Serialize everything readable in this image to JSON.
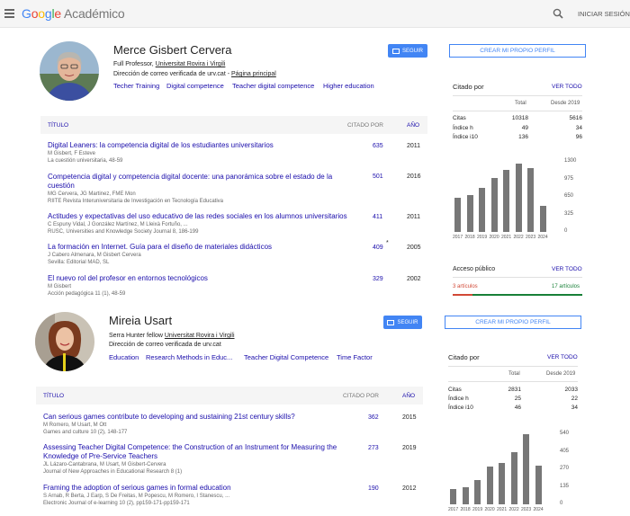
{
  "header": {
    "logo_parts": [
      "G",
      "o",
      "o",
      "g",
      "l",
      "e"
    ],
    "logo_suffix": "Académico",
    "signin_label": "INICIAR SESIÓN"
  },
  "profiles": [
    {
      "name": "Merce Gisbert Cervera",
      "position_prefix": "Full Professor, ",
      "affiliation": "Universitat Rovira i Virgili",
      "email_prefix": "Dirección de correo verificada de urv.cat - ",
      "homepage_label": "Página principal",
      "follow_label": "SEGUIR",
      "create_profile_label": "CREAR MI PROPIO PERFIL",
      "keywords": [
        "Techer Training",
        "Digital competence",
        "Teacher digital competence",
        "Higher education"
      ],
      "table": {
        "title_label": "TÍTULO",
        "cited_label": "CITADO POR",
        "year_label": "AÑO"
      },
      "publications": [
        {
          "title": "Digital Leaners: la competencia digital de los estudiantes universitarios",
          "authors": "M Gisbert, F Esteve",
          "venue": "La cuestión universitaria, 48-59",
          "cites": "635",
          "year": "2011",
          "star": ""
        },
        {
          "title": "Competencia digital y competencia digital docente: una panorámica sobre el estado de la cuestión",
          "authors": "MG Cervera, JG Martinez, FME Mon",
          "venue": "RIITE Revista Interuniversitaria de Investigación en Tecnología Educativa",
          "cites": "501",
          "year": "2016",
          "star": ""
        },
        {
          "title": "Actitudes y expectativas del uso educativo de las redes sociales en los alumnos universitarios",
          "authors": "C Espuny Vidal, J González Martínez, M Lleixà Fortuño, ...",
          "venue": "RUSC, Universities and Knowledge Society Journal 8, 186-199",
          "cites": "411",
          "year": "2011",
          "star": ""
        },
        {
          "title": "La formación en Internet. Guía para el diseño de materiales didácticos",
          "authors": "J Cabero Almenara, M Gisbert Cervera",
          "venue": "Sevilla: Editorial MAD, SL",
          "cites": "409",
          "year": "2005",
          "star": "*"
        },
        {
          "title": "El nuevo rol del profesor en entornos tecnológicos",
          "authors": "M Gisbert",
          "venue": "Acción pedagógica 11 (1), 48-59",
          "cites": "329",
          "year": "2002",
          "star": ""
        }
      ],
      "cited_by": {
        "title": "Citado por",
        "view_all": "VER TODO",
        "col_all": "Total",
        "col_since": "Desde 2019",
        "rows": [
          {
            "label": "Citas",
            "total": "10318",
            "since": "5616"
          },
          {
            "label": "Índice h",
            "total": "49",
            "since": "34"
          },
          {
            "label": "Índice i10",
            "total": "136",
            "since": "96"
          }
        ]
      },
      "chart_data": {
        "type": "bar",
        "categories": [
          "2017",
          "2018",
          "2019",
          "2020",
          "2021",
          "2022",
          "2023",
          "2024"
        ],
        "values": [
          640,
          690,
          810,
          1000,
          1150,
          1270,
          1180,
          480
        ],
        "ylim": [
          0,
          1300
        ],
        "yticks": [
          "1300",
          "975",
          "650",
          "325",
          "0"
        ]
      },
      "public_access": {
        "title": "Acceso público",
        "view_all": "VER TODO",
        "not_available": "3 artículos",
        "available": "17 artículos",
        "available_fraction": 0.85
      }
    },
    {
      "name": "Mireia Usart",
      "position_prefix": "Serra Hunter fellow ",
      "affiliation": "Universitat Rovira i Virgili",
      "email_prefix": "Dirección de correo verificada de urv.cat",
      "homepage_label": "",
      "follow_label": "SEGUIR",
      "create_profile_label": "CREAR MI PROPIO PERFIL",
      "keywords": [
        "Education",
        "Research Methods in Educ...",
        "Teacher Digital Competence",
        "Time Factor"
      ],
      "table": {
        "title_label": "TÍTULO",
        "cited_label": "CITADO POR",
        "year_label": "AÑO"
      },
      "publications": [
        {
          "title": "Can serious games contribute to developing and sustaining 21st century skills?",
          "authors": "M Romero, M Usart, M Ott",
          "venue": "Games and culture 10 (2), 148-177",
          "cites": "362",
          "year": "2015",
          "star": ""
        },
        {
          "title": "Assessing Teacher Digital Competence: the Construction of an Instrument for Measuring the Knowledge of Pre-Service Teachers",
          "authors": "JL Lázaro-Cantabrana, M Usart, M Gisbert-Cervera",
          "venue": "Journal of New Approaches in Educational Research 8 (1)",
          "cites": "273",
          "year": "2019",
          "star": ""
        },
        {
          "title": "Framing the adoption of serious games in formal education",
          "authors": "S Arnab, R Berta, J Earp, S De Freitas, M Popescu, M Romero, I Stanescu, ...",
          "venue": "Electronic Journal of e-learning 10 (2), pp159-171-pp159-171",
          "cites": "190",
          "year": "2012",
          "star": ""
        }
      ],
      "cited_by": {
        "title": "Citado por",
        "view_all": "VER TODO",
        "col_all": "Total",
        "col_since": "Desde 2019",
        "rows": [
          {
            "label": "Citas",
            "total": "2831",
            "since": "2033"
          },
          {
            "label": "Índice h",
            "total": "25",
            "since": "22"
          },
          {
            "label": "Índice i10",
            "total": "46",
            "since": "34"
          }
        ]
      },
      "chart_data": {
        "type": "bar",
        "categories": [
          "2017",
          "2018",
          "2019",
          "2020",
          "2021",
          "2022",
          "2023",
          "2024"
        ],
        "values": [
          120,
          130,
          190,
          290,
          320,
          400,
          540,
          300
        ],
        "ylim": [
          0,
          540
        ],
        "yticks": [
          "540",
          "405",
          "270",
          "135",
          "0"
        ]
      }
    }
  ],
  "colors": {
    "accent_blue": "#4285f4",
    "link": "#1a0dab",
    "bar": "#777777",
    "oa_red": "#d14836",
    "oa_green": "#188038"
  }
}
